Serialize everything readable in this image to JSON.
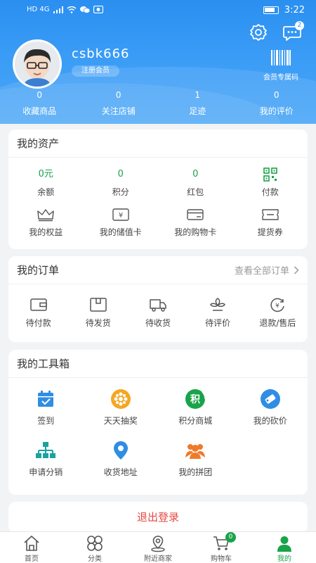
{
  "status_bar": {
    "left_glyphs": "HD 4G",
    "time": "3:22"
  },
  "header": {
    "username": "csbk666",
    "member_tag": "注册会员",
    "member_code_label": "会员专属码",
    "notification_count": "2",
    "stats": [
      {
        "value": "0",
        "label": "收藏商品"
      },
      {
        "value": "0",
        "label": "关注店铺"
      },
      {
        "value": "1",
        "label": "足迹"
      },
      {
        "value": "0",
        "label": "我的评价"
      }
    ]
  },
  "assets": {
    "title": "我的资产",
    "row1": [
      {
        "value": "0元",
        "label": "余额"
      },
      {
        "value": "0",
        "label": "积分"
      },
      {
        "value": "0",
        "label": "红包"
      },
      {
        "icon": "qr-pay-icon",
        "label": "付款"
      }
    ],
    "row2": [
      {
        "icon": "crown-icon",
        "label": "我的权益"
      },
      {
        "icon": "stored-value-card-icon",
        "label": "我的储值卡"
      },
      {
        "icon": "shopping-card-icon",
        "label": "我的购物卡"
      },
      {
        "icon": "coupon-icon",
        "label": "提货券"
      }
    ]
  },
  "orders": {
    "title": "我的订单",
    "view_all": "查看全部订单",
    "items": [
      {
        "icon": "wallet-icon",
        "label": "待付款"
      },
      {
        "icon": "box-icon",
        "label": "待发货"
      },
      {
        "icon": "truck-icon",
        "label": "待收货"
      },
      {
        "icon": "review-icon",
        "label": "待评价"
      },
      {
        "icon": "refund-icon",
        "label": "退款/售后"
      }
    ]
  },
  "tools": {
    "title": "我的工具箱",
    "items": [
      {
        "icon": "checkin-icon",
        "label": "签到",
        "color": "#2f8de4"
      },
      {
        "icon": "lottery-icon",
        "label": "天天抽奖",
        "color": "#f5a623"
      },
      {
        "icon": "points-mall-icon",
        "label": "积分商城",
        "color": "#1aa34a",
        "glyph": "积"
      },
      {
        "icon": "bargain-icon",
        "label": "我的砍价",
        "color": "#2f8de4"
      },
      {
        "icon": "distribution-icon",
        "label": "申请分销",
        "color": "#1aa3a0"
      },
      {
        "icon": "location-icon",
        "label": "收货地址",
        "color": "#2f8de4"
      },
      {
        "icon": "group-buy-icon",
        "label": "我的拼团",
        "color": "#f07a2a"
      }
    ]
  },
  "logout_label": "退出登录",
  "bottom_nav": [
    {
      "icon": "home-icon",
      "label": "首页"
    },
    {
      "icon": "category-icon",
      "label": "分类"
    },
    {
      "icon": "nearby-icon",
      "label": "附近商家"
    },
    {
      "icon": "cart-icon",
      "label": "购物车",
      "badge": "0"
    },
    {
      "icon": "profile-icon",
      "label": "我的",
      "active": true
    }
  ],
  "colors": {
    "header_blue": "#2a8ff0",
    "accent_green": "#1aa34a",
    "logout_red": "#e24a42"
  }
}
